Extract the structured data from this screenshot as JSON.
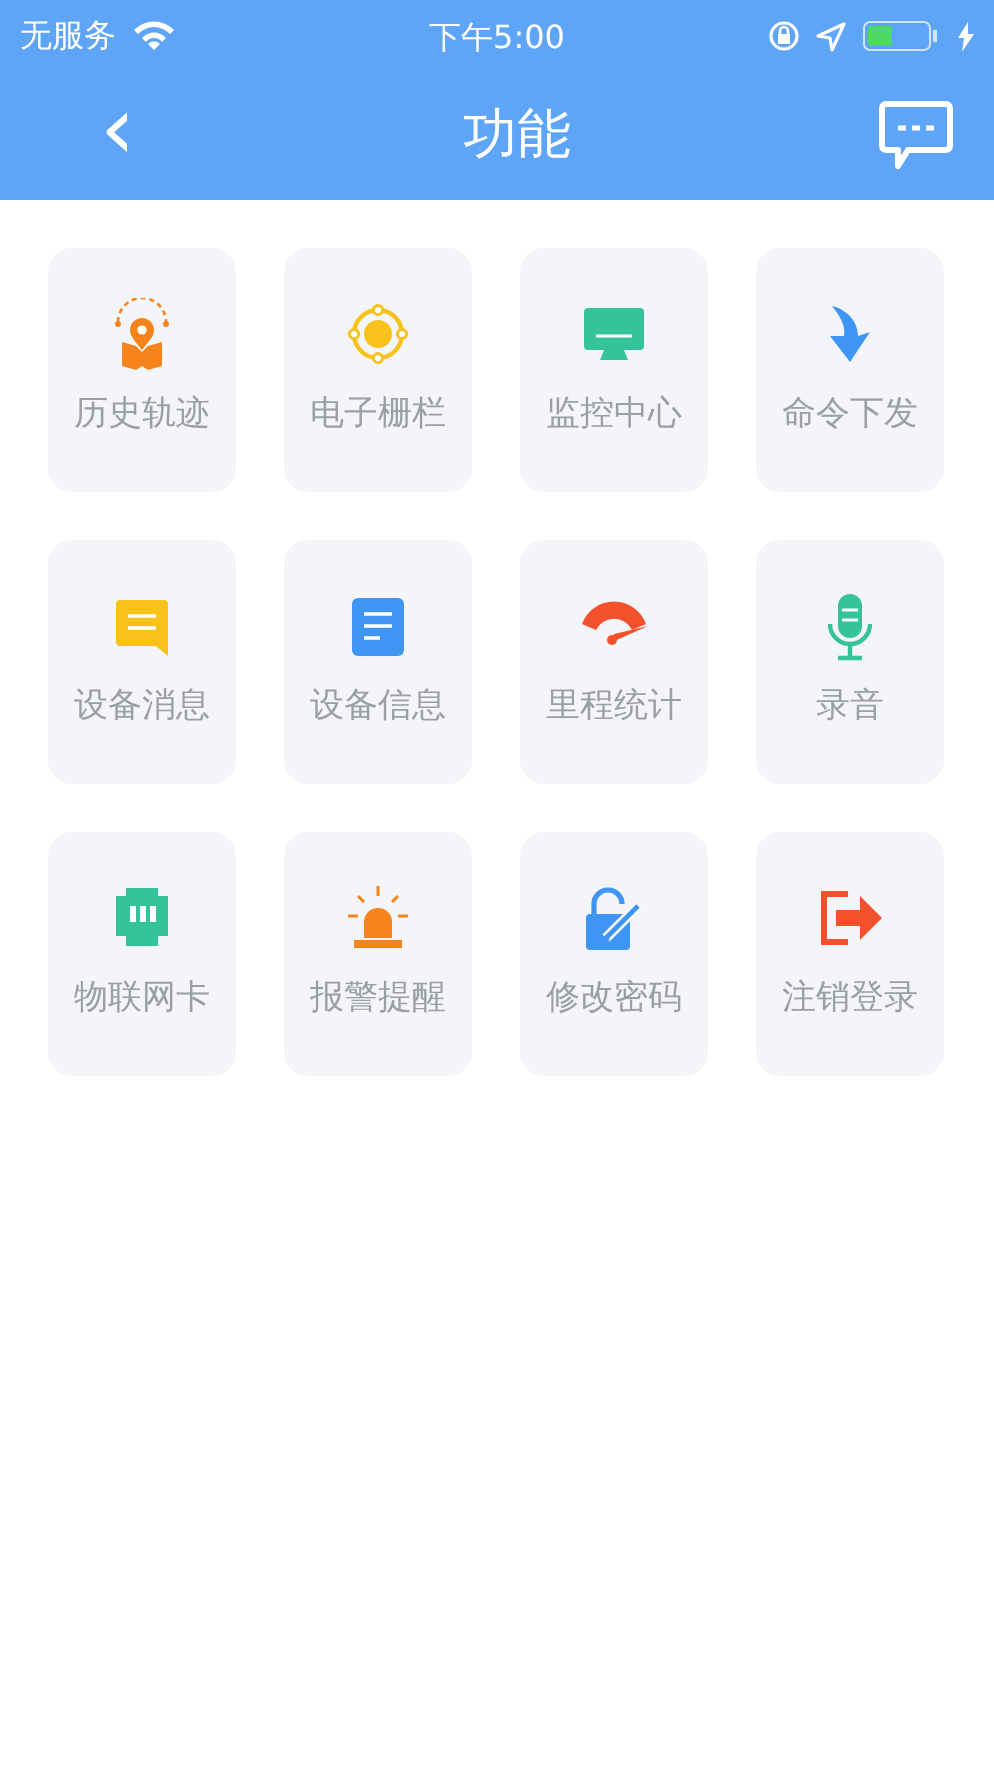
{
  "status_bar": {
    "carrier": "无服务",
    "time": "下午5:00"
  },
  "header": {
    "back": "‹",
    "title": "功能"
  },
  "tiles": [
    {
      "kind": "track",
      "label": "历史轨迹"
    },
    {
      "kind": "fence",
      "label": "电子栅栏"
    },
    {
      "kind": "monitor",
      "label": "监控中心"
    },
    {
      "kind": "command",
      "label": "命令下发"
    },
    {
      "kind": "message",
      "label": "设备消息"
    },
    {
      "kind": "info",
      "label": "设备信息"
    },
    {
      "kind": "mileage",
      "label": "里程统计"
    },
    {
      "kind": "record",
      "label": "录音"
    },
    {
      "kind": "simcard",
      "label": "物联网卡"
    },
    {
      "kind": "alarm",
      "label": "报警提醒"
    },
    {
      "kind": "password",
      "label": "修改密码"
    },
    {
      "kind": "logout",
      "label": "注销登录"
    }
  ]
}
